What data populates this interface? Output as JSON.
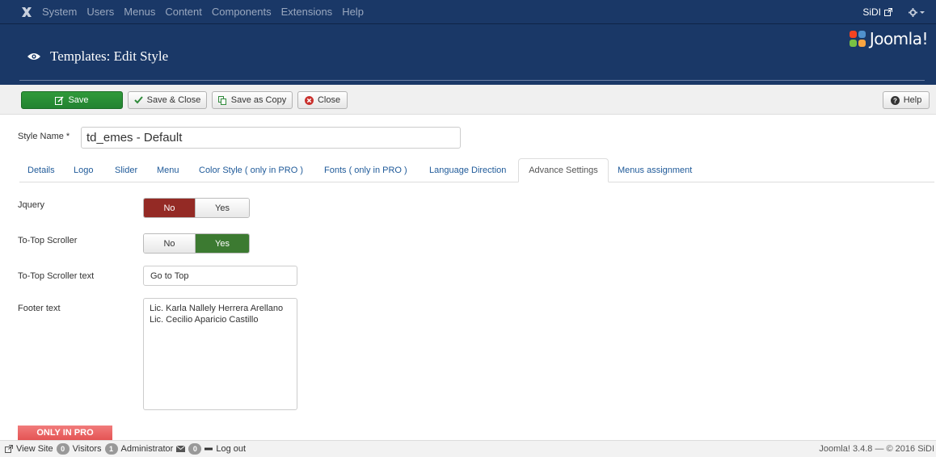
{
  "navbar": {
    "menu": [
      "System",
      "Users",
      "Menus",
      "Content",
      "Components",
      "Extensions",
      "Help"
    ],
    "user": "SiDI"
  },
  "header": {
    "title": "Templates: Edit Style",
    "brand": "Joomla!"
  },
  "toolbar": {
    "save": "Save",
    "save_close": "Save & Close",
    "save_copy": "Save as Copy",
    "close": "Close",
    "help": "Help"
  },
  "form": {
    "style_name_label": "Style Name *",
    "style_name_value": "td_emes - Default"
  },
  "tabs": [
    "Details",
    "Logo",
    "Slider",
    "Menu",
    "Color Style ( only in PRO )",
    "Fonts ( only in PRO )",
    "Language Direction",
    "Advance Settings",
    "Menus assignment"
  ],
  "settings": {
    "jquery": {
      "label": "Jquery",
      "no": "No",
      "yes": "Yes",
      "selected": "No"
    },
    "totop": {
      "label": "To-Top Scroller",
      "no": "No",
      "yes": "Yes",
      "selected": "Yes"
    },
    "totop_text": {
      "label": "To-Top Scroller text",
      "value": "Go to Top"
    },
    "footer": {
      "label": "Footer text",
      "line1": "Lic. Karla Nallely Herrera Arellano",
      "line2": "Lic. Cecilio Aparicio Castillo"
    },
    "pro_badge": "ONLY IN PRO"
  },
  "status": {
    "view_site": "View Site",
    "visitors_count": "0",
    "visitors": "Visitors",
    "admin_count": "1",
    "admin": "Administrator",
    "messages_count": "0",
    "logout": "Log out",
    "version": "Joomla! 3.4.8 — © 2016 SiDI"
  },
  "colors": {
    "header_bg": "#1a3867",
    "save_green": "#2f9a3a",
    "toggle_red": "#942a25",
    "toggle_green": "#3c7a31",
    "link_blue": "#1f5a99"
  }
}
